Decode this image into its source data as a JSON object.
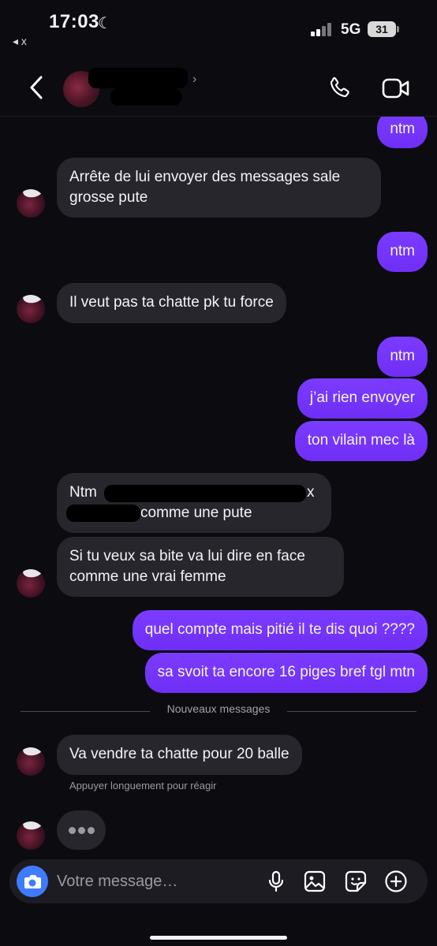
{
  "status_bar": {
    "time": "17:03",
    "back_app_label": "◂ x",
    "network": "5G",
    "battery": "31"
  },
  "header": {
    "icons": [
      "back-icon",
      "phone-icon",
      "video-call-icon"
    ]
  },
  "messages": [
    {
      "side": "out",
      "text": "ntm"
    },
    {
      "side": "in",
      "text": "Arrête de lui envoyer des messages sale grosse pute"
    },
    {
      "side": "out",
      "text": "ntm"
    },
    {
      "side": "in",
      "text": "Il veut pas ta chatte pk tu force"
    },
    {
      "side": "out",
      "text": "ntm"
    },
    {
      "side": "out",
      "text": "j’ai rien envoyer"
    },
    {
      "side": "out",
      "text": "ton vilain mec là"
    },
    {
      "side": "in",
      "text_start": "Ntm",
      "text_mid": "x",
      "text_end": "comme une pute"
    },
    {
      "side": "in",
      "text": "Si tu veux sa bite va lui dire en face comme une vrai femme"
    },
    {
      "side": "out",
      "text": "quel compte mais pitié il te dis quoi ????"
    },
    {
      "side": "out",
      "text": "sa svoit ta encore 16 piges bref tgl mtn"
    },
    {
      "side": "in",
      "text": "Va vendre ta chatte pour 20 balle"
    }
  ],
  "divider_label": "Nouveaux messages",
  "hint": "Appuyer longuement pour réagir",
  "composer": {
    "placeholder": "Votre message…",
    "accent_color": "#3f7bff",
    "icons": [
      "camera-icon",
      "microphone-icon",
      "gallery-icon",
      "sticker-icon",
      "add-icon"
    ]
  },
  "colors": {
    "outgoing_bubble": "#7a35ff",
    "incoming_bubble": "#26262c",
    "background": "#0b0b10"
  }
}
